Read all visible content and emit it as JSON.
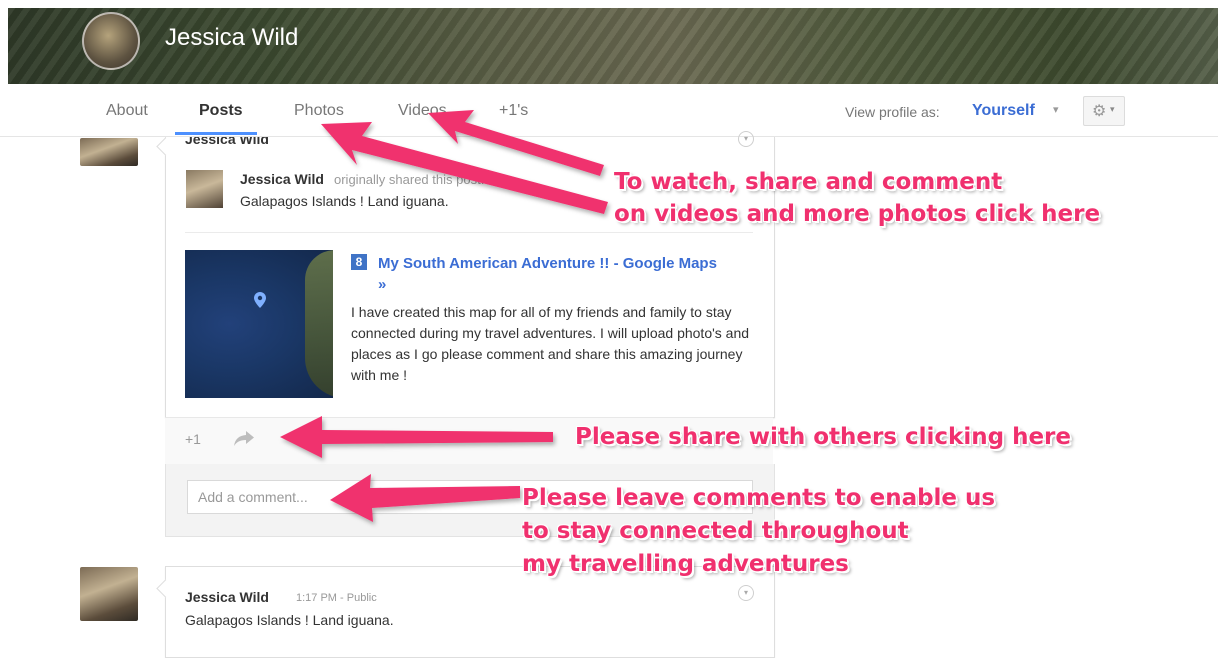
{
  "profile": {
    "name": "Jessica Wild"
  },
  "tabs": [
    {
      "label": "About"
    },
    {
      "label": "Posts",
      "active": true
    },
    {
      "label": "Photos"
    },
    {
      "label": "Videos"
    },
    {
      "label": "+1's"
    }
  ],
  "view_as": {
    "label": "View profile as:",
    "value": "Yourself",
    "caret": "▾"
  },
  "settings": {
    "icon": "gear-icon",
    "caret": "▾"
  },
  "post1": {
    "author": "Jessica Wild",
    "menu_icon": "chevron-down-icon",
    "shared": {
      "author": "Jessica Wild",
      "meta": "originally shared this post:",
      "text": "Galapagos Islands ! Land iguana."
    },
    "link": {
      "icon": "google-maps-icon",
      "icon_char": "8",
      "title": "My South American Adventure !! - Google Maps »",
      "description": "I have created this map for all of my friends and family to stay connected during my travel adventures. I will upload photo's and places as I go please comment and share this amazing journey with me !"
    },
    "actions": {
      "plus_one": "+1",
      "share_icon": "share-icon"
    },
    "comment_placeholder": "Add a comment..."
  },
  "post2": {
    "author": "Jessica Wild",
    "time": "1:17 PM  -  Public",
    "text": "Galapagos Islands ! Land iguana."
  },
  "annotations": {
    "tabs_note_line1": "To watch, share and comment",
    "tabs_note_line2": "on videos and more photos click here",
    "share_note": "Please share with others clicking here",
    "comment_note_line1": "Please leave comments to enable us",
    "comment_note_line2": "to stay connected throughout",
    "comment_note_line3": "my travelling adventures",
    "color": "#f0306e"
  },
  "colors": {
    "accent": "#4d90fe",
    "link": "#3b6dd4"
  }
}
